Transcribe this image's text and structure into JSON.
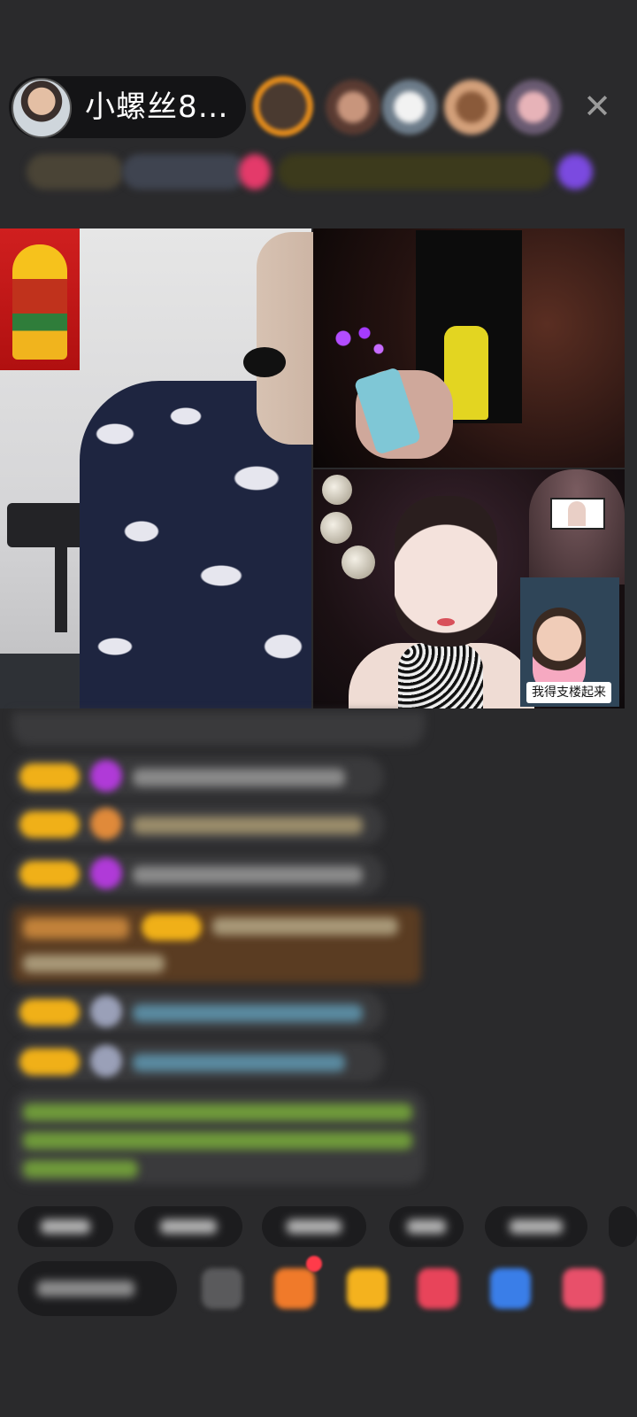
{
  "header": {
    "host_name": "小螺丝8…",
    "close_glyph": "✕"
  },
  "video": {
    "kid_caption": "我得支楼起来"
  },
  "colors": {
    "background": "#2a2a2c",
    "level_badge": "#f0b018",
    "chat_bubble": "#3a3a3c",
    "highlight_bubble": "#5a3c22",
    "system_text_green": "#8fd14f",
    "gift_red": "#ff3b4a"
  },
  "icons": {
    "close": "close-icon",
    "comment": "chat-icon",
    "gift": "gift-icon",
    "share": "share-icon"
  }
}
